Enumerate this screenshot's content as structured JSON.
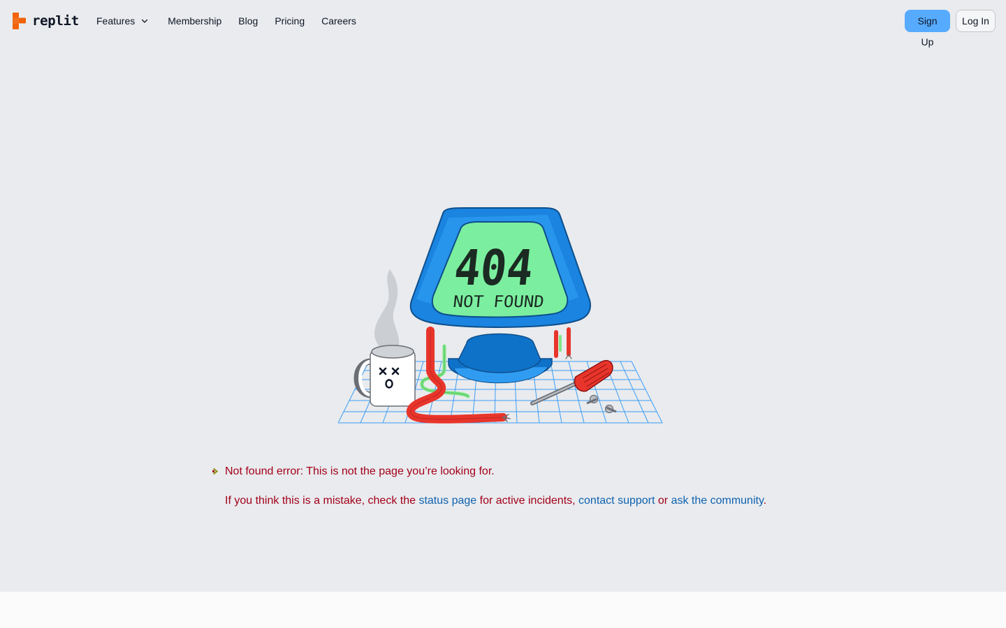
{
  "brand": {
    "name": "replit",
    "accent": "#f26207"
  },
  "nav": {
    "features_label": "Features",
    "items": [
      {
        "label": "Membership"
      },
      {
        "label": "Blog"
      },
      {
        "label": "Pricing"
      },
      {
        "label": "Careers"
      }
    ]
  },
  "auth": {
    "signup_label": "Sign Up",
    "login_label": "Log In"
  },
  "illustration": {
    "screen_code": "404",
    "screen_caption": "NOT FOUND"
  },
  "error": {
    "title": "Not found error: This is not the page you’re looking for.",
    "hint_prefix": "If you think this is a mistake, check the ",
    "status_link": "status page",
    "hint_mid1": " for active incidents, ",
    "support_link": "contact support",
    "hint_mid2": " or ",
    "community_link": "ask the community",
    "hint_suffix": "."
  },
  "colors": {
    "page_bg": "#e9ebee",
    "error_text": "#a3001a",
    "link": "#0f62b0",
    "signup_bg": "#57abff"
  }
}
